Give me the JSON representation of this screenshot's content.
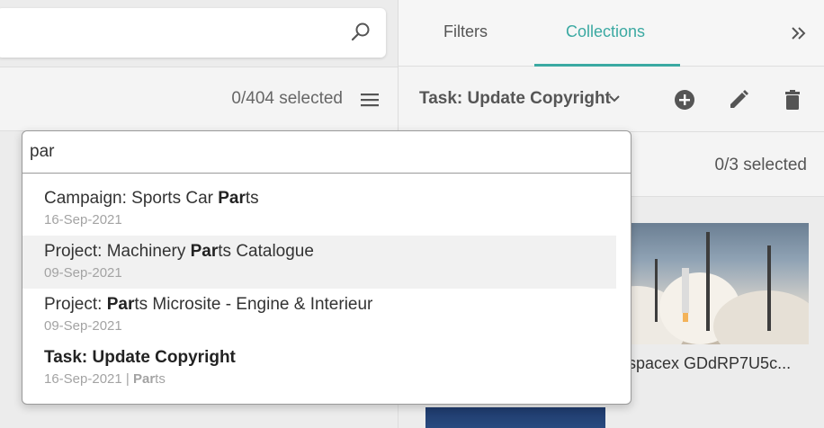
{
  "search": {
    "placeholder": "",
    "icon": "search-icon"
  },
  "assets": {
    "selected_count": "0/404 selected"
  },
  "tabs": [
    {
      "label": "Filters",
      "active": false
    },
    {
      "label": "Collections",
      "active": true
    }
  ],
  "collection": {
    "title": "Task: Update Copyright",
    "selected_count": "0/3 selected",
    "thumbnail_name": "spacex GDdRP7U5c..."
  },
  "dropdown": {
    "query": "par",
    "items": [
      {
        "prefix": "Campaign: Sports Car ",
        "match": "Par",
        "suffix": "ts",
        "date": "16-Sep-2021",
        "sub_extra": ""
      },
      {
        "prefix": "Project: Machinery ",
        "match": "Par",
        "suffix": "ts Catalogue",
        "date": "09-Sep-2021",
        "sub_extra": ""
      },
      {
        "prefix": "Project: ",
        "match": "Par",
        "suffix": "ts Microsite - Engine & Interieur",
        "date": "09-Sep-2021",
        "sub_extra": ""
      },
      {
        "prefix": "Task: Update Copyright",
        "match": "",
        "suffix": "",
        "date": "16-Sep-2021 | ",
        "sub_match": "Par",
        "sub_suffix": "ts"
      }
    ]
  },
  "colors": {
    "accent": "#3ba9a2",
    "icon": "#555555"
  }
}
